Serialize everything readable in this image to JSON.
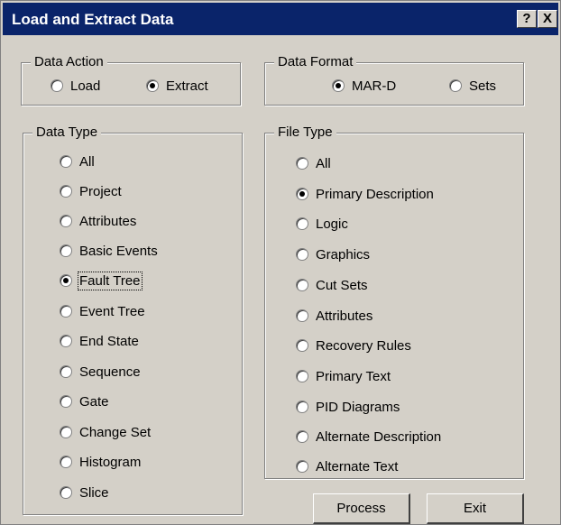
{
  "window": {
    "title": "Load and Extract Data",
    "help_label": "?",
    "close_label": "X"
  },
  "data_action": {
    "title": "Data Action",
    "options": [
      "Load",
      "Extract"
    ],
    "selected": "Extract"
  },
  "data_format": {
    "title": "Data Format",
    "options": [
      "MAR-D",
      "Sets"
    ],
    "selected": "MAR-D"
  },
  "data_type": {
    "title": "Data Type",
    "options": [
      "All",
      "Project",
      "Attributes",
      "Basic Events",
      "Fault Tree",
      "Event Tree",
      "End State",
      "Sequence",
      "Gate",
      "Change Set",
      "Histogram",
      "Slice"
    ],
    "selected": "Fault Tree"
  },
  "file_type": {
    "title": "File Type",
    "options": [
      "All",
      "Primary Description",
      "Logic",
      "Graphics",
      "Cut Sets",
      "Attributes",
      "Recovery Rules",
      "Primary Text",
      "PID Diagrams",
      "Alternate Description",
      "Alternate Text"
    ],
    "selected": "Primary Description"
  },
  "buttons": {
    "process": "Process",
    "exit": "Exit"
  }
}
